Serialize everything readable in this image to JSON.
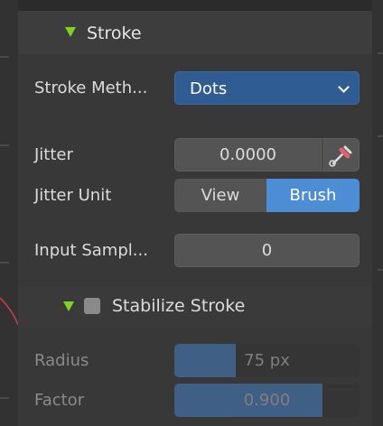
{
  "stroke_panel": {
    "title": "Stroke",
    "stroke_method": {
      "label": "Stroke Meth...",
      "value": "Dots"
    },
    "jitter": {
      "label": "Jitter",
      "value": "0.0000"
    },
    "jitter_unit": {
      "label": "Jitter Unit",
      "options": [
        "View",
        "Brush"
      ],
      "selected": "Brush"
    },
    "input_samples": {
      "label": "Input Sampl...",
      "value": "0"
    }
  },
  "stabilize_panel": {
    "title": "Stabilize Stroke",
    "enabled": false,
    "radius": {
      "label": "Radius",
      "value": "75 px",
      "fill_fraction": 0.33
    },
    "factor": {
      "label": "Factor",
      "value": "0.900",
      "fill_fraction": 0.8
    }
  },
  "colors": {
    "accent_blue": "#4d8dd6",
    "dropdown_blue": "#2f5d93",
    "expand_arrow_green": "#7ed321"
  },
  "icons": {
    "panel_toggle": "triangle-down-icon",
    "eyedropper": "eyedropper-icon",
    "dropdown": "chevron-down-icon"
  }
}
